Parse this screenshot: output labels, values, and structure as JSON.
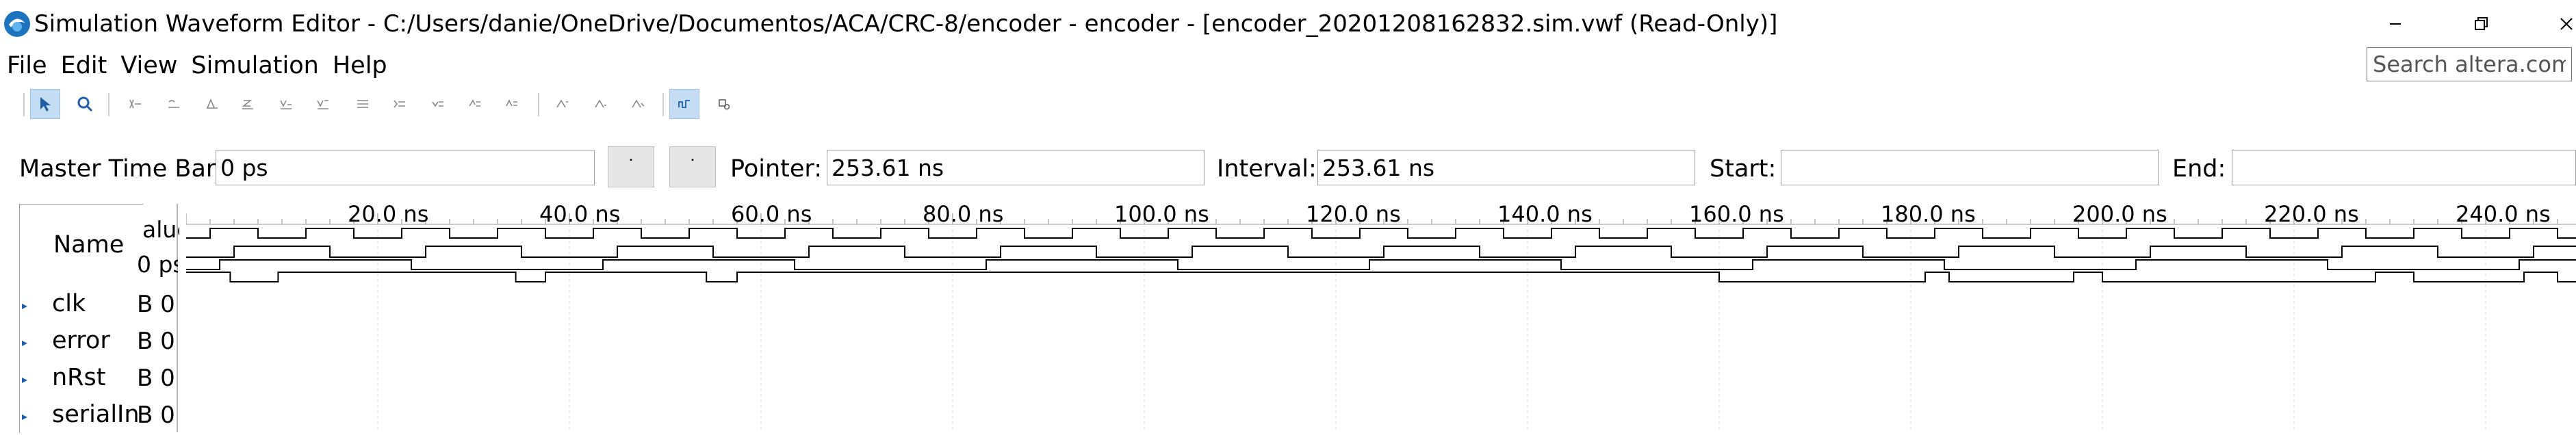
{
  "window": {
    "title": "Simulation Waveform Editor - C:/Users/danie/OneDrive/Documentos/ACA/CRC-8/encoder - encoder - [encoder_20201208162832.sim.vwf (Read-Only)]",
    "icon": "quartus-app-icon"
  },
  "menu": [
    "File",
    "Edit",
    "View",
    "Simulation",
    "Help"
  ],
  "search": {
    "placeholder": "Search altera.com"
  },
  "toolbar": {
    "icons": [
      "selection-tool-icon",
      "zoom-tool-icon",
      "forcing-unknown-icon",
      "forcing-low-icon",
      "forcing-high-icon",
      "high-impedance-icon",
      "weak-low-icon",
      "weak-high-icon",
      "invert-icon",
      "count-value-icon",
      "clock-value-icon",
      "arbitrary-value-icon",
      "random-value-icon",
      "snap-to-grid-icon",
      "sort-icon",
      "group-icon",
      "waveform-view-icon",
      "settings-icon"
    ]
  },
  "timebar": {
    "master_label": "Master Time Bar:",
    "master_value": "0 ps",
    "prev_label": "˙",
    "next_label": "˙",
    "pointer_label": "Pointer:",
    "pointer_value": "253.61 ns",
    "interval_label": "Interval:",
    "interval_value": "253.61 ns",
    "start_label": "Start:",
    "start_value": "",
    "end_label": "End:",
    "end_value": ""
  },
  "waveform": {
    "name_header": "Name",
    "value_header_line1": "alue",
    "value_header_line2": "0 ps",
    "time_ticks": [
      "20.0 ns",
      "40.0 ns",
      "60.0 ns",
      "80.0 ns",
      "100.0 ns",
      "120.0 ns",
      "140.0 ns",
      "160.0 ns",
      "180.0 ns",
      "200.0 ns",
      "220.0 ns",
      "240.0 ns"
    ],
    "signals": [
      {
        "name": "clk",
        "value": "B 0"
      },
      {
        "name": "error",
        "value": "B 0"
      },
      {
        "name": "nRst",
        "value": "B 0"
      },
      {
        "name": "serialIn",
        "value": "B 0"
      }
    ]
  }
}
